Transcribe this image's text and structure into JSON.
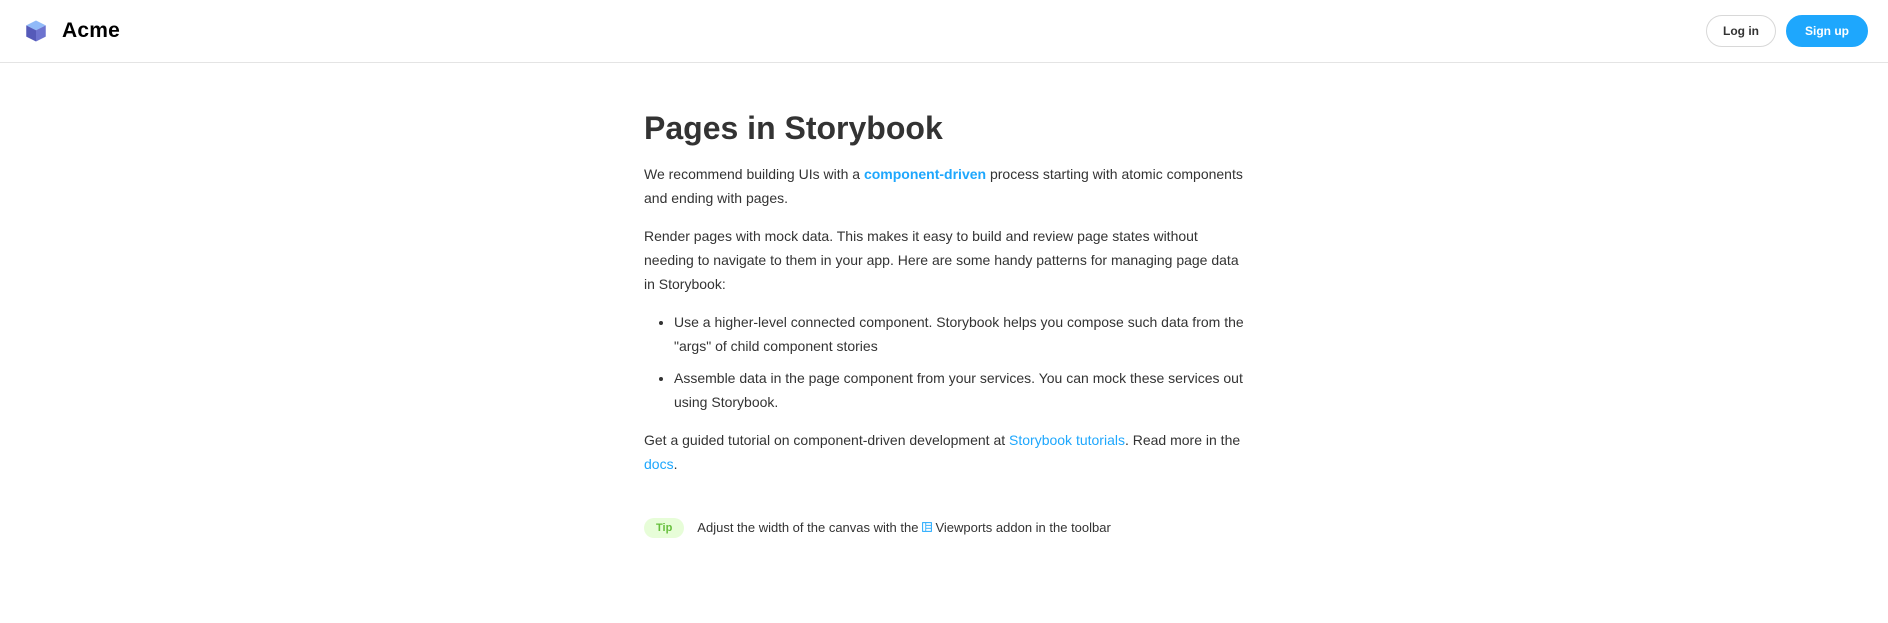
{
  "header": {
    "brand_name": "Acme",
    "logo_icon": "cube-logo-icon",
    "login_label": "Log in",
    "signup_label": "Sign up"
  },
  "main": {
    "title": "Pages in Storybook",
    "intro": {
      "before": "We recommend building UIs with a ",
      "link": "component-driven",
      "after": " process starting with atomic components and ending with pages."
    },
    "render_paragraph": "Render pages with mock data. This makes it easy to build and review page states without needing to navigate to them in your app. Here are some handy patterns for managing page data in Storybook:",
    "list": [
      "Use a higher-level connected component. Storybook helps you compose such data from the \"args\" of child component stories",
      "Assemble data in the page component from your services. You can mock these services out using Storybook."
    ],
    "guide": {
      "before": "Get a guided tutorial on component-driven development at ",
      "tutorials_link": "Storybook tutorials",
      "middle": ". Read more in the ",
      "docs_link": "docs",
      "after": "."
    },
    "tip": {
      "badge": "Tip",
      "before": "Adjust the width of the canvas with the ",
      "icon": "viewport-icon",
      "after": "Viewports addon in the toolbar"
    }
  },
  "colors": {
    "accent": "#1ea7fd",
    "text": "#333333",
    "tip_bg": "#e7fdd8",
    "tip_text": "#66bf3c"
  }
}
